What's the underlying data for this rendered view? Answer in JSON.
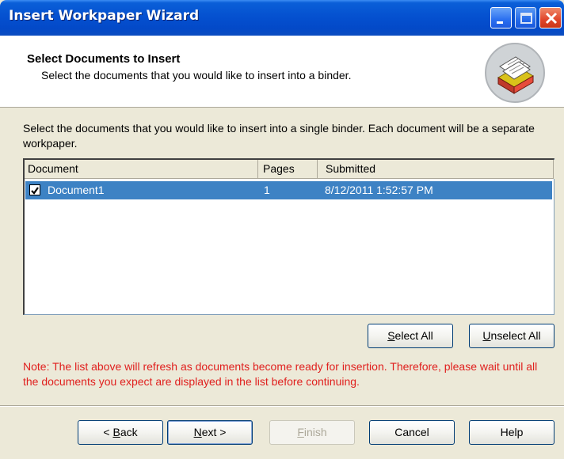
{
  "window": {
    "title": "Insert Workpaper Wizard"
  },
  "header": {
    "title": "Select Documents to Insert",
    "subtitle": "Select the documents that you would like to insert into a binder."
  },
  "instructions": "Select the documents that you would like to insert into a single binder.  Each document will be a separate workpaper.",
  "list": {
    "columns": [
      "Document",
      "Pages",
      "Submitted"
    ],
    "rows": [
      {
        "document": "Document1",
        "pages": "1",
        "submitted": "8/12/2011 1:52:57 PM",
        "checked": true,
        "selected": true
      }
    ]
  },
  "buttons": {
    "select_all": {
      "before": "",
      "key": "S",
      "after": "elect All"
    },
    "unselect_all": {
      "before": "",
      "key": "U",
      "after": "nselect All"
    },
    "back": {
      "before": "< ",
      "key": "B",
      "after": "ack"
    },
    "next": {
      "before": "",
      "key": "N",
      "after": "ext >"
    },
    "finish": {
      "before": "",
      "key": "F",
      "after": "inish"
    },
    "cancel": "Cancel",
    "help": "Help"
  },
  "note": "Note: The list above will refresh as documents become ready for insertion.  Therefore, please wait until all the documents you expect are displayed in the list before continuing.",
  "colors": {
    "title_bar": "#0551d0",
    "selection": "#3d82c4",
    "note_text": "#e0201e",
    "dialog_face": "#ece9d8"
  }
}
